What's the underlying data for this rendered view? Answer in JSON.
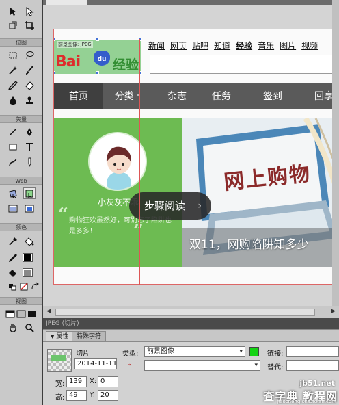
{
  "toolbox": {
    "sections": {
      "bitmap": "位图",
      "vector": "矢量",
      "web": "Web",
      "colors": "颜色",
      "view": "视图"
    }
  },
  "canvas": {
    "logo_slice": {
      "label": "前景图像: JPEG",
      "logo_text_baidu": "Bai",
      "logo_text_du": "du",
      "logo_text_jingyan": "经验"
    },
    "top_links": [
      "新闻",
      "网页",
      "贴吧",
      "知道",
      "经验",
      "音乐",
      "图片",
      "视频"
    ],
    "nav_items": [
      "首页",
      "分类",
      "杂志",
      "任务",
      "签到",
      "回享"
    ],
    "user_name": "小灰灰不乖",
    "quote": "购物狂欢虽然好，可别忘了陷阱也是多多！",
    "quote_open": "“",
    "quote_close": "”",
    "hero_sign": "网上购物",
    "hero_caption": "双11，网购陷阱知多少",
    "step_pill": "步骤阅读",
    "step_chevron": "›"
  },
  "status_bar": "JPEG (切片)",
  "properties": {
    "tabs": [
      "属性",
      "特殊字符"
    ],
    "slice_label": "切片",
    "slice_name": "2014-11-11_",
    "type_label": "类型:",
    "type_value": "前景图像",
    "link_label": "链接:",
    "alt_label": "替代:",
    "width_label": "宽:",
    "width_value": "139",
    "height_label": "高:",
    "height_value": "49",
    "x_label": "X:",
    "x_value": "0",
    "y_label": "Y:",
    "y_value": "20",
    "slice_color": "#13d313"
  },
  "watermark": {
    "line1": "jb51.net",
    "line2": "查字典 教程网",
    "line3": "jiaocheng.chazidian.com"
  }
}
